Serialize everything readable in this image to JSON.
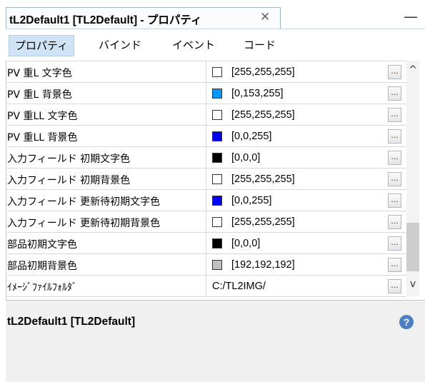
{
  "tab": {
    "title": "tL2Default1 [TL2Default] - プロパティ",
    "close": "✕"
  },
  "window": {
    "minimize": "—"
  },
  "subtabs": [
    {
      "label": "プロパティ"
    },
    {
      "label": "バインド"
    },
    {
      "label": "イベント"
    },
    {
      "label": "コード"
    }
  ],
  "properties": [
    {
      "name": "PV 重L 文字色",
      "value": "[255,255,255]",
      "color": "#ffffff"
    },
    {
      "name": "PV 重L 背景色",
      "value": "[0,153,255]",
      "color": "#0099ff"
    },
    {
      "name": "PV 重LL 文字色",
      "value": "[255,255,255]",
      "color": "#ffffff"
    },
    {
      "name": "PV 重LL 背景色",
      "value": "[0,0,255]",
      "color": "#0000ff"
    },
    {
      "name": "入力フィールド 初期文字色",
      "value": "[0,0,0]",
      "color": "#000000"
    },
    {
      "name": "入力フィールド 初期背景色",
      "value": "[255,255,255]",
      "color": "#ffffff"
    },
    {
      "name": "入力フィールド 更新待初期文字色",
      "value": "[0,0,255]",
      "color": "#0000ff"
    },
    {
      "name": "入力フィールド 更新待初期背景色",
      "value": "[255,255,255]",
      "color": "#ffffff"
    },
    {
      "name": "部品初期文字色",
      "value": "[0,0,0]",
      "color": "#000000"
    },
    {
      "name": "部品初期背景色",
      "value": "[192,192,192]",
      "color": "#c0c0c0"
    },
    {
      "name": "ｲﾒｰｼﾞﾌｧｲﾙﾌｫﾙﾀﾞ",
      "value": "C:/TL2IMG/",
      "color": ""
    }
  ],
  "ellipsis": "...",
  "description": {
    "title": "tL2Default1 [TL2Default]"
  },
  "scrollbar": {
    "up": "^",
    "down": "v"
  },
  "help": {
    "symbol": "?"
  }
}
